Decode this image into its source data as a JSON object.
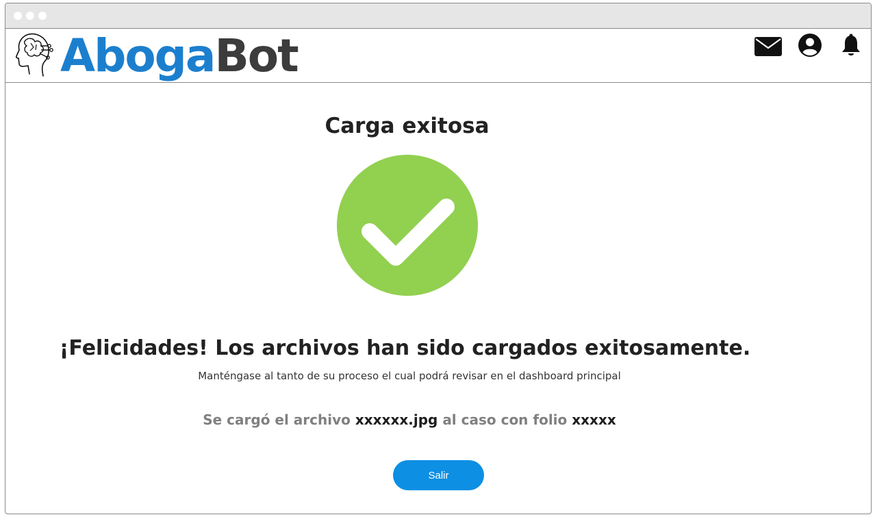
{
  "app": {
    "brand_part1": "Aboga",
    "brand_part2": "Bot",
    "accent_color": "#1c7fce",
    "brand_dark_color": "#3c3c3c"
  },
  "header": {
    "icons": [
      "brain-logo-icon",
      "mail-icon",
      "user-account-icon",
      "bell-icon"
    ]
  },
  "main": {
    "title": "Carga exitosa",
    "status_icon": "check-circle-icon",
    "status_color": "#92d050",
    "congrats": "¡Felicidades! Los archivos han sido cargados exitosamente.",
    "subtitle": "Manténgase al tanto de su proceso el cual podrá revisar en el dashboard principal",
    "info": {
      "prefix": "Se cargó el archivo",
      "filename": "xxxxxx.jpg",
      "middle": "al caso con folio",
      "folio": "xxxxx"
    },
    "exit_label": "Salir",
    "button_color": "#0d8fe3"
  }
}
